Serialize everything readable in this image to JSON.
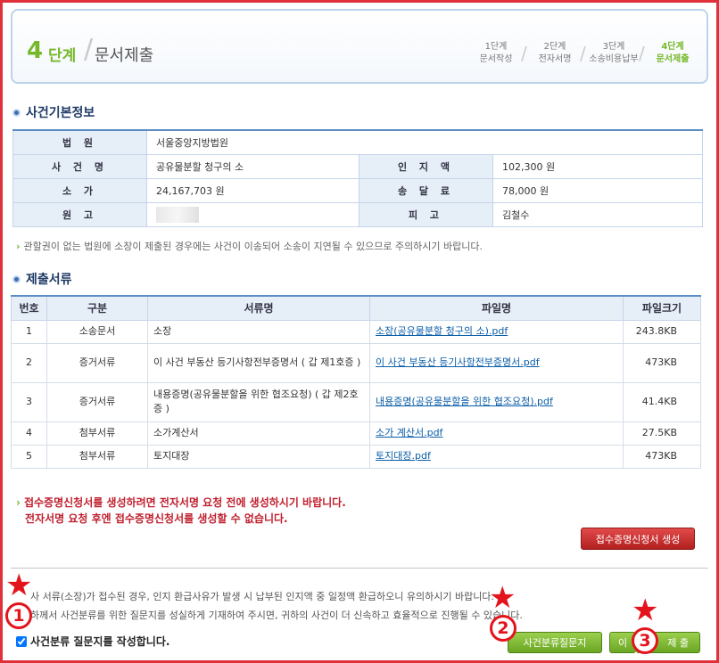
{
  "header": {
    "step_num": "4",
    "step_word": "단계",
    "title": "문서제출",
    "steps": [
      {
        "num": "1단계",
        "label": "문서작성"
      },
      {
        "num": "2단계",
        "label": "전자서명"
      },
      {
        "num": "3단계",
        "label": "소송비용납부"
      },
      {
        "num": "4단계",
        "label": "문서제출"
      }
    ]
  },
  "case_info": {
    "title": "사건기본정보",
    "court_label": "법 원",
    "court": "서울중앙지방법원",
    "case_name_label": "사 건 명",
    "case_name": "공유물분할 청구의 소",
    "stamp_label": "인 지 액",
    "stamp": "102,300 원",
    "value_label": "소 가",
    "value": "24,167,703 원",
    "delivery_label": "송 달 료",
    "delivery": "78,000 원",
    "plaintiff_label": "원 고",
    "plaintiff": "",
    "defendant_label": "피 고",
    "defendant": "김철수",
    "notice": "관할권이 없는 법원에 소장이 제출된 경우에는 사건이 이송되어 소송이 지연될 수 있으므로 주의하시기 바랍니다."
  },
  "documents": {
    "title": "제출서류",
    "headers": [
      "번호",
      "구분",
      "서류명",
      "파일명",
      "파일크기"
    ],
    "rows": [
      {
        "no": "1",
        "type": "소송문서",
        "name": "소장",
        "file": "소장(공유물분할 청구의 소).pdf",
        "size": "243.8KB"
      },
      {
        "no": "2",
        "type": "증거서류",
        "name": "이 사건 부동산 등기사항전부증명서 ( 갑 제1호증 )",
        "file": "이 사건 부동산 등기사항전부증명서.pdf",
        "size": "473KB"
      },
      {
        "no": "3",
        "type": "증거서류",
        "name": "내용증명(공유물분할을 위한 협조요청) ( 갑 제2호증 )",
        "file": "내용증명(공유물분할을 위한 협조요청).pdf",
        "size": "41.4KB"
      },
      {
        "no": "4",
        "type": "첨부서류",
        "name": "소가계산서",
        "file": "소가 계산서.pdf",
        "size": "27.5KB"
      },
      {
        "no": "5",
        "type": "첨부서류",
        "name": "토지대장",
        "file": "토지대장.pdf",
        "size": "473KB"
      }
    ]
  },
  "warning": {
    "line1": "접수증명신청서를 생성하려면 전자서명 요청 전에 생성하시기 바랍니다.",
    "line2": "전자서명 요청 후엔 접수증명신청서를 생성할 수 없습니다."
  },
  "buttons": {
    "receipt": "접수증명신청서 생성",
    "questionnaire": "사건분류질문지",
    "prev": "이",
    "submit": "제 출"
  },
  "footer": {
    "line1": "사 서류(소장)가 접수된 경우, 인지 환급사유가 발생 시 납부된 인지액 중 일정액 환급하오니 유의하시기 바랍니다.",
    "line2": "하께서 사건분류를 위한 질문지를 성실하게 기재하여 주시면, 귀하의 사건이 더 신속하고 효율적으로 진행될 수 있습니다.",
    "checkbox": "사건분류 질문지를 작성합니다."
  },
  "annotations": {
    "one": "1",
    "two": "2",
    "three": "3"
  },
  "colors": {
    "accent_green": "#76b82a",
    "annotation_red": "#e4141d",
    "header_blue": "#1e3a66"
  }
}
